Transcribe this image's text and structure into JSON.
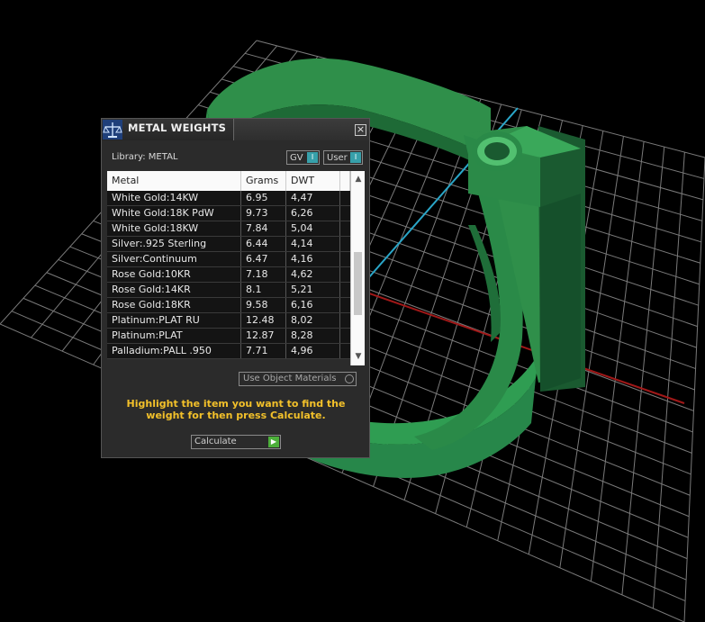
{
  "panel": {
    "title": "METAL WEIGHTS",
    "library_label": "Library: METAL",
    "gv_label": "GV",
    "user_label": "User",
    "toggle_indicator": "I",
    "close_glyph": "×",
    "columns": {
      "metal": "Metal",
      "grams": "Grams",
      "dwt": "DWT"
    },
    "rows": [
      {
        "metal": "White Gold:14KW",
        "grams": "6.95",
        "dwt": "4,47"
      },
      {
        "metal": "White Gold:18K PdW",
        "grams": "9.73",
        "dwt": "6,26"
      },
      {
        "metal": "White Gold:18KW",
        "grams": "7.84",
        "dwt": "5,04"
      },
      {
        "metal": "Silver:.925 Sterling",
        "grams": "6.44",
        "dwt": "4,14"
      },
      {
        "metal": "Silver:Continuum",
        "grams": "6.47",
        "dwt": "4,16"
      },
      {
        "metal": "Rose Gold:10KR",
        "grams": "7.18",
        "dwt": "4,62"
      },
      {
        "metal": "Rose Gold:14KR",
        "grams": "8.1",
        "dwt": "5,21"
      },
      {
        "metal": "Rose Gold:18KR",
        "grams": "9.58",
        "dwt": "6,16"
      },
      {
        "metal": "Platinum:PLAT RU",
        "grams": "12.48",
        "dwt": "8,02"
      },
      {
        "metal": "Platinum:PLAT",
        "grams": "12.87",
        "dwt": "8,28"
      },
      {
        "metal": "Palladium:PALL .950",
        "grams": "7.71",
        "dwt": "4,96"
      }
    ],
    "use_object_materials_label": "Use Object Materials",
    "instructions": "Highlight the item you want to find the weight for then press Calculate.",
    "calculate_label": "Calculate",
    "scroll_up_glyph": "▲",
    "scroll_down_glyph": "▼",
    "go_glyph": "▶"
  },
  "colors": {
    "accent_yellow": "#f3c12a",
    "toggle_teal": "#37a0aa",
    "go_green": "#4caf3a",
    "ring_green": "#2f8f4a"
  },
  "icons": {
    "app": "scale-icon",
    "close": "close-icon",
    "go": "play-arrow-icon"
  }
}
